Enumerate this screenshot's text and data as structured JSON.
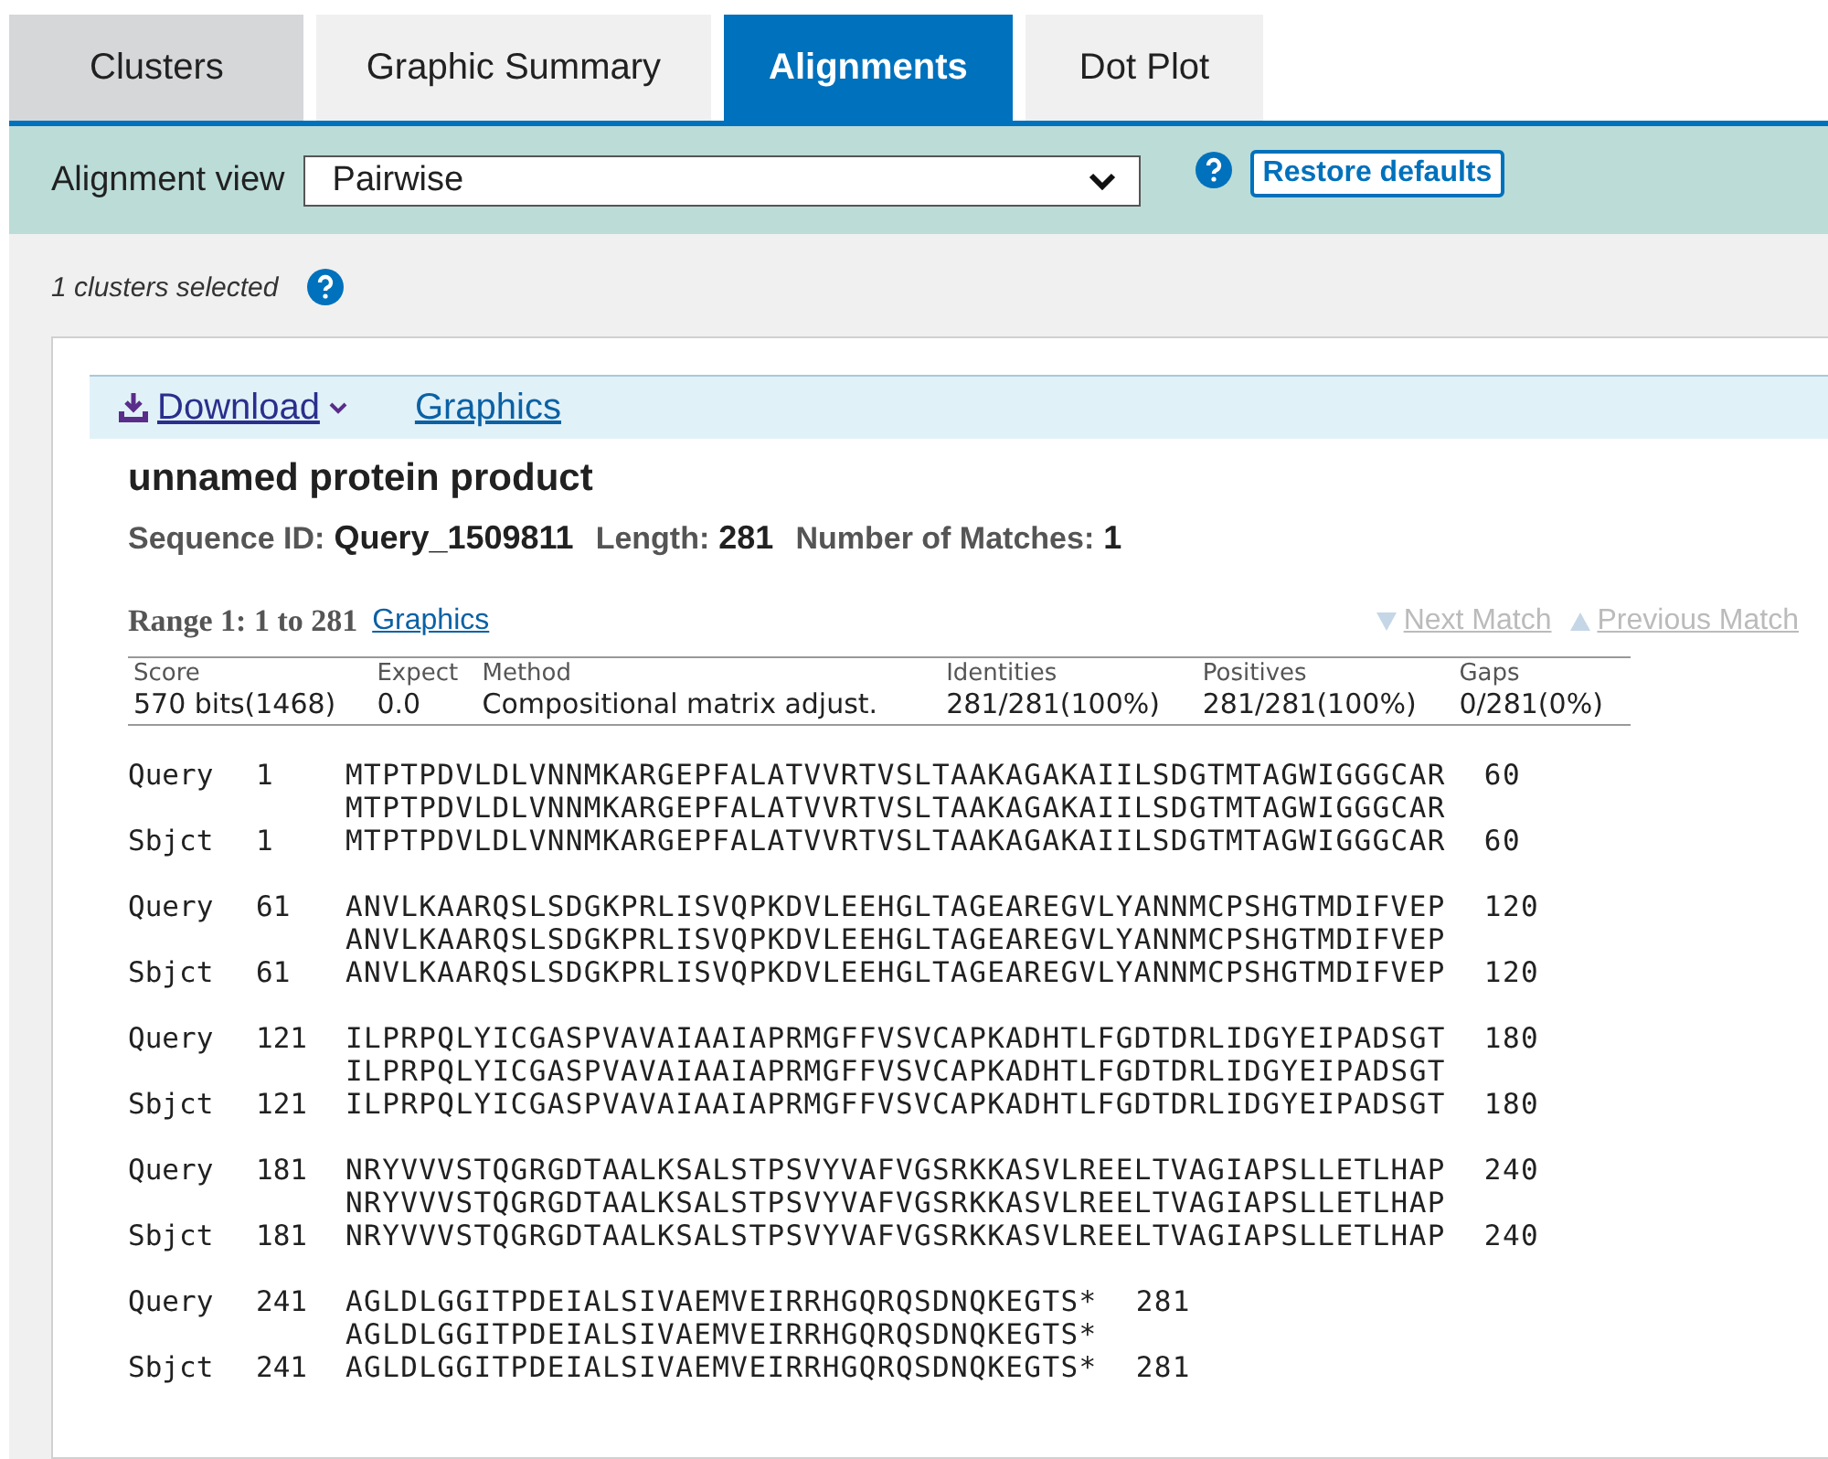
{
  "tabs": [
    {
      "label": "Clusters",
      "selected": false,
      "kind": "dark"
    },
    {
      "label": "Graphic Summary",
      "selected": false,
      "kind": "light"
    },
    {
      "label": "Alignments",
      "selected": true,
      "kind": "light"
    },
    {
      "label": "Dot Plot",
      "selected": false,
      "kind": "light"
    }
  ],
  "toolbar": {
    "label": "Alignment view",
    "select_value": "Pairwise",
    "restore_button": "Restore defaults"
  },
  "selection_note": "1 clusters selected",
  "result": {
    "download": "Download",
    "graphics": "Graphics",
    "title": "unnamed protein product",
    "meta": [
      {
        "label": "Sequence ID:",
        "value": "Query_1509811"
      },
      {
        "label": "Length:",
        "value": "281"
      },
      {
        "label": "Number of Matches:",
        "value": "1"
      }
    ],
    "range": {
      "label": "Range 1: 1 to 281",
      "link": "Graphics"
    },
    "nav": [
      {
        "label": "Next Match",
        "kind": "down",
        "disabled": true
      },
      {
        "label": "Previous Match",
        "kind": "up",
        "disabled": true
      }
    ],
    "stats": {
      "columns": [
        "Score",
        "Expect",
        "Method",
        "Identities",
        "Positives",
        "Gaps"
      ],
      "values": [
        "570 bits(1468)",
        "0.0",
        "Compositional matrix adjust.",
        "281/281(100%)",
        "281/281(100%)",
        "0/281(0%)"
      ]
    },
    "blocks": [
      {
        "rows": [
          {
            "kind": "seq",
            "label": "Query",
            "start": "1",
            "seq": "MTPTPDVLDLVNNMKARGEPFALATVVRTVSLTAAKAGAKAIILSDGTMTAGWIGGGCAR",
            "end": "60"
          },
          {
            "kind": "midline",
            "seq": "MTPTPDVLDLVNNMKARGEPFALATVVRTVSLTAAKAGAKAIILSDGTMTAGWIGGGCAR"
          },
          {
            "kind": "seq",
            "label": "Sbjct",
            "start": "1",
            "seq": "MTPTPDVLDLVNNMKARGEPFALATVVRTVSLTAAKAGAKAIILSDGTMTAGWIGGGCAR",
            "end": "60"
          }
        ]
      },
      {
        "rows": [
          {
            "kind": "seq",
            "label": "Query",
            "start": "61",
            "seq": "ANVLKAARQSLSDGKPRLISVQPKDVLEEHGLTAGEAREGVLYANNMCPSHGTMDIFVEP",
            "end": "120"
          },
          {
            "kind": "midline",
            "seq": "ANVLKAARQSLSDGKPRLISVQPKDVLEEHGLTAGEAREGVLYANNMCPSHGTMDIFVEP"
          },
          {
            "kind": "seq",
            "label": "Sbjct",
            "start": "61",
            "seq": "ANVLKAARQSLSDGKPRLISVQPKDVLEEHGLTAGEAREGVLYANNMCPSHGTMDIFVEP",
            "end": "120"
          }
        ]
      },
      {
        "rows": [
          {
            "kind": "seq",
            "label": "Query",
            "start": "121",
            "seq": "ILPRPQLYICGASPVAVAIAAIAPRMGFFVSVCAPKADHTLFGDTDRLIDGYEIPADSGT",
            "end": "180"
          },
          {
            "kind": "midline",
            "seq": "ILPRPQLYICGASPVAVAIAAIAPRMGFFVSVCAPKADHTLFGDTDRLIDGYEIPADSGT"
          },
          {
            "kind": "seq",
            "label": "Sbjct",
            "start": "121",
            "seq": "ILPRPQLYICGASPVAVAIAAIAPRMGFFVSVCAPKADHTLFGDTDRLIDGYEIPADSGT",
            "end": "180"
          }
        ]
      },
      {
        "rows": [
          {
            "kind": "seq",
            "label": "Query",
            "start": "181",
            "seq": "NRYVVVSTQGRGDTAALKSALSTPSVYVAFVGSRKKASVLREELTVAGIAPSLLETLHAP",
            "end": "240"
          },
          {
            "kind": "midline",
            "seq": "NRYVVVSTQGRGDTAALKSALSTPSVYVAFVGSRKKASVLREELTVAGIAPSLLETLHAP"
          },
          {
            "kind": "seq",
            "label": "Sbjct",
            "start": "181",
            "seq": "NRYVVVSTQGRGDTAALKSALSTPSVYVAFVGSRKKASVLREELTVAGIAPSLLETLHAP",
            "end": "240"
          }
        ]
      },
      {
        "rows": [
          {
            "kind": "seq",
            "label": "Query",
            "start": "241",
            "seq": "AGLDLGGITPDEIALSIVAEMVEIRRHGQRQSDNQKEGTS*",
            "end": "281"
          },
          {
            "kind": "midline",
            "seq": "AGLDLGGITPDEIALSIVAEMVEIRRHGQRQSDNQKEGTS*"
          },
          {
            "kind": "seq",
            "label": "Sbjct",
            "start": "241",
            "seq": "AGLDLGGITPDEIALSIVAEMVEIRRHGQRQSDNQKEGTS*",
            "end": "281"
          }
        ]
      }
    ]
  }
}
